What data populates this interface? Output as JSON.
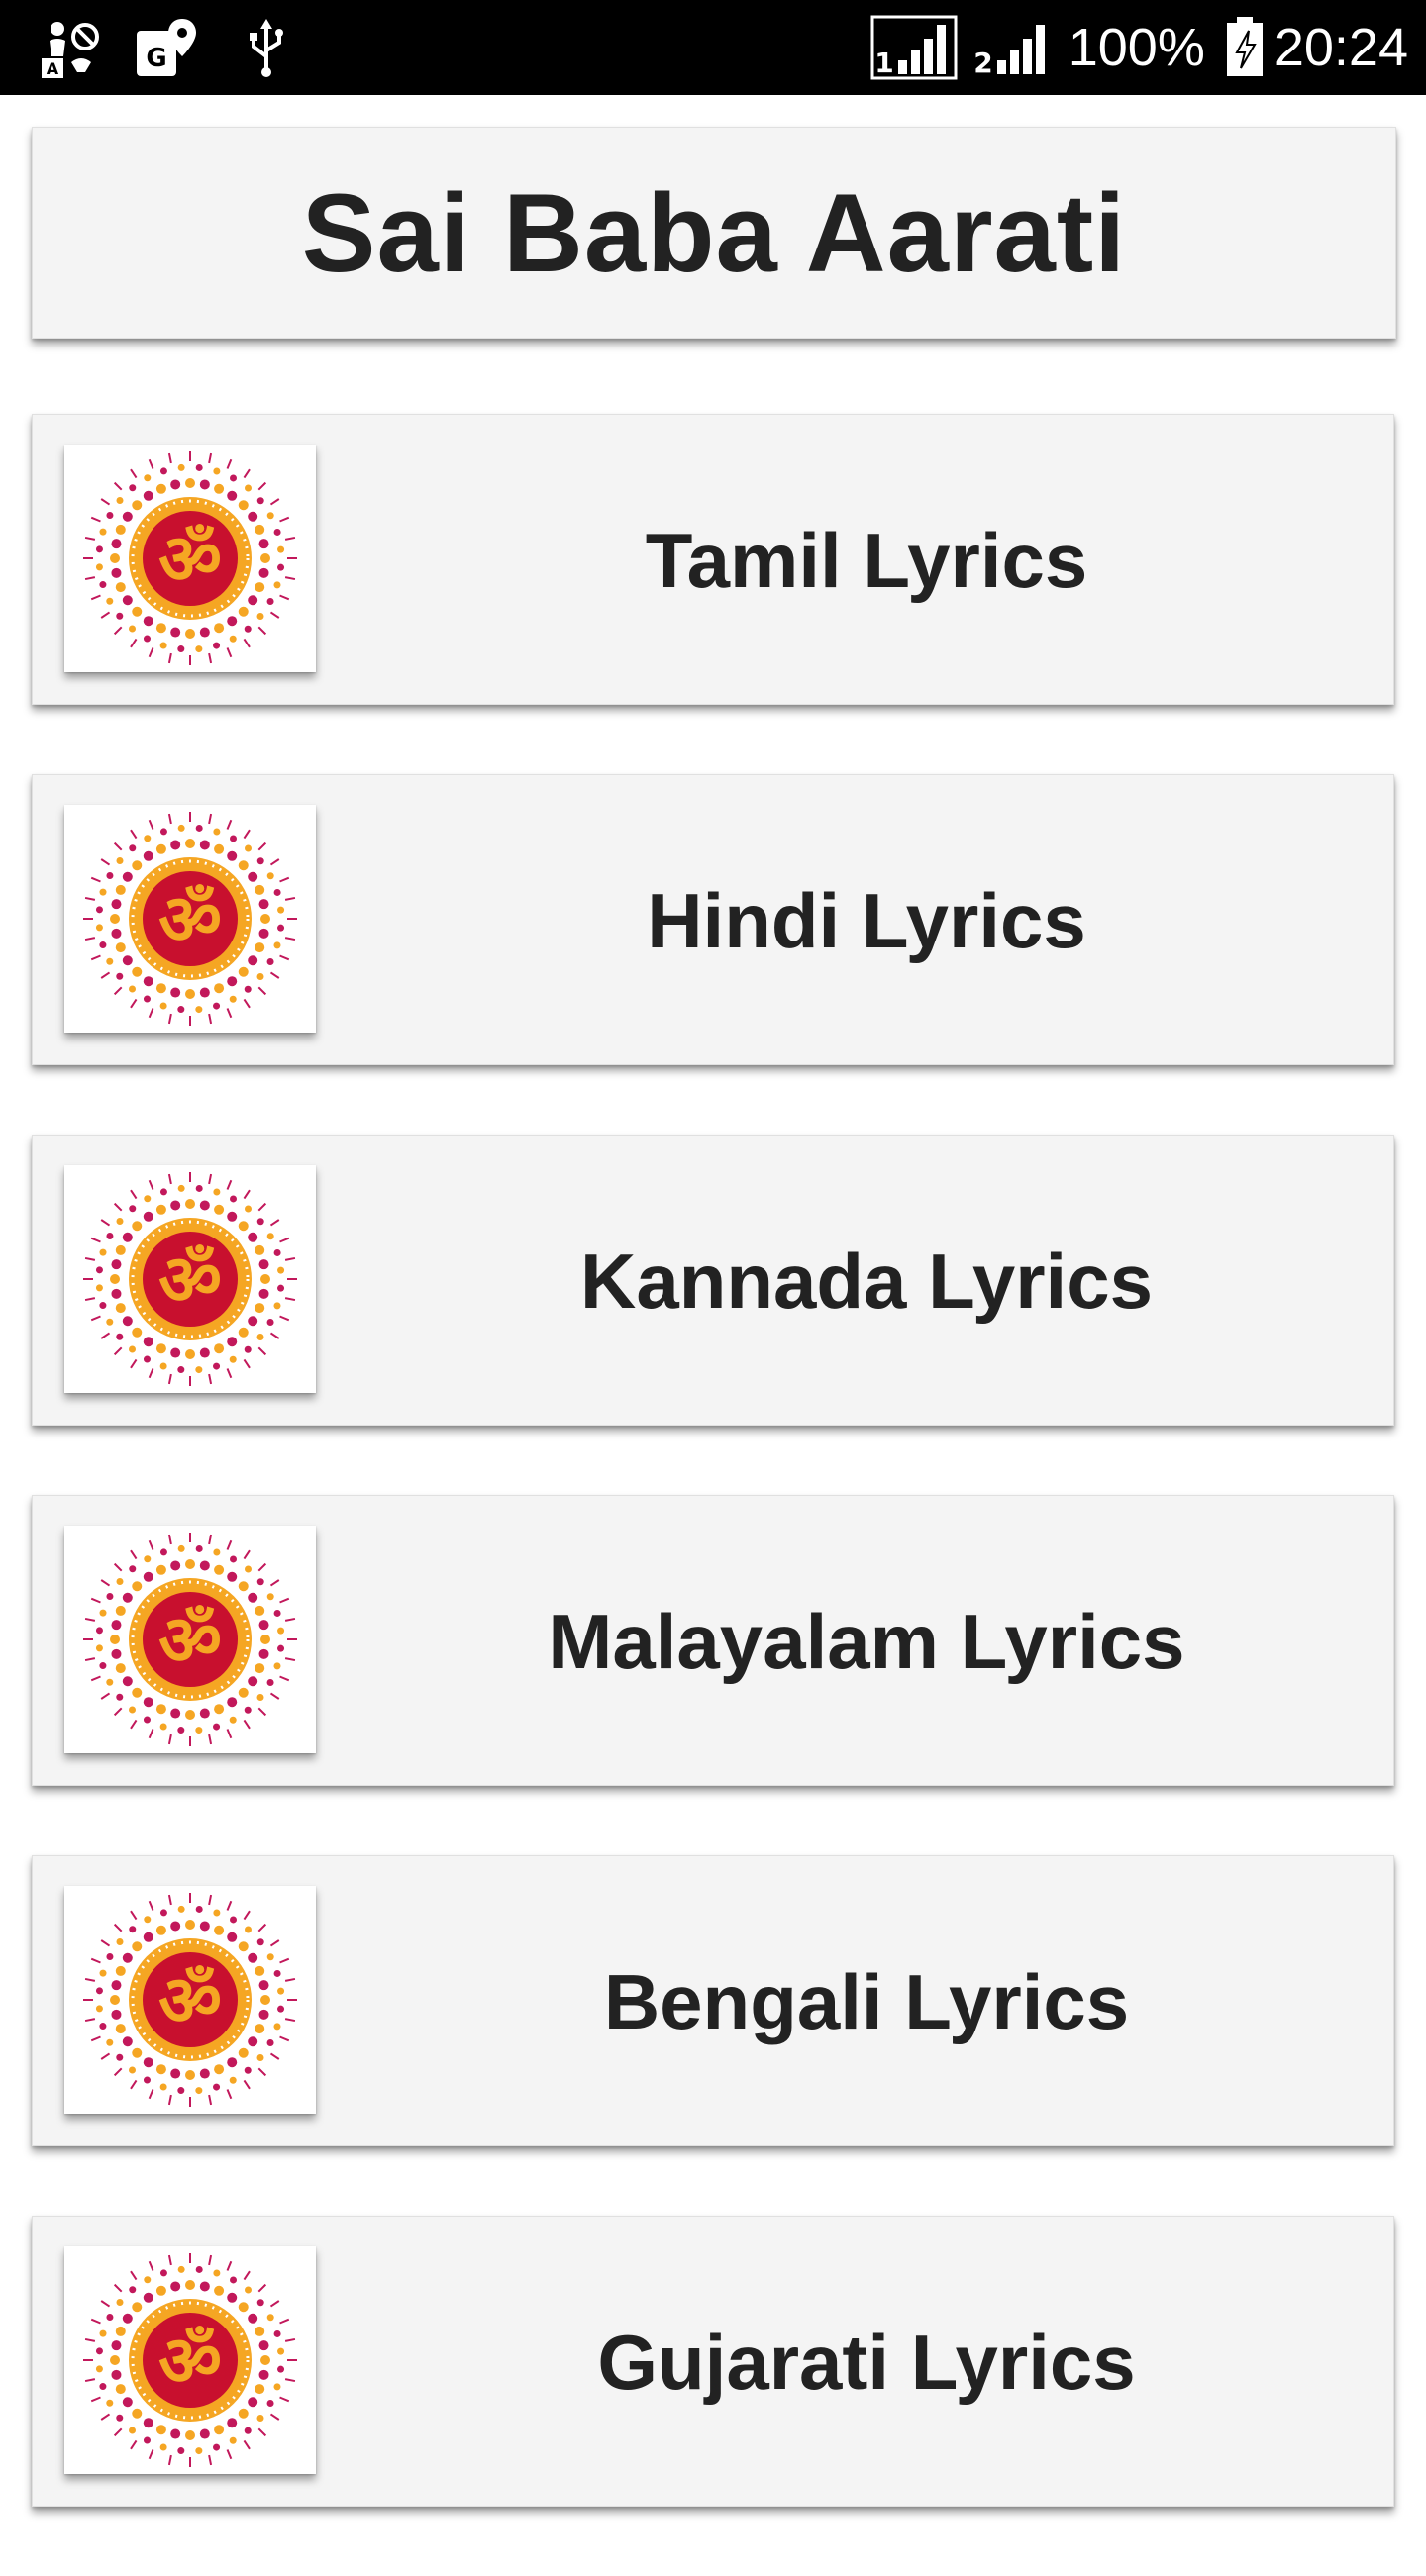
{
  "status_bar": {
    "battery_percent": "100%",
    "time": "20:24",
    "icons": [
      "accessibility-icon",
      "gps-location-icon",
      "usb-icon",
      "sim1-signal-icon",
      "sim2-signal-icon",
      "battery-charging-icon"
    ]
  },
  "header": {
    "title": "Sai Baba Aarati"
  },
  "colors": {
    "om_red": "#c8102e",
    "om_orange": "#f5a623",
    "dot_pink": "#c2185b",
    "text_dark": "#222222",
    "card_bg": "#f4f4f4"
  },
  "list": {
    "items": [
      {
        "label": "Tamil Lyrics",
        "icon": "om-mandala-icon"
      },
      {
        "label": "Hindi Lyrics",
        "icon": "om-mandala-icon"
      },
      {
        "label": "Kannada Lyrics",
        "icon": "om-mandala-icon"
      },
      {
        "label": "Malayalam Lyrics",
        "icon": "om-mandala-icon"
      },
      {
        "label": "Bengali Lyrics",
        "icon": "om-mandala-icon"
      },
      {
        "label": "Gujarati Lyrics",
        "icon": "om-mandala-icon"
      }
    ]
  }
}
